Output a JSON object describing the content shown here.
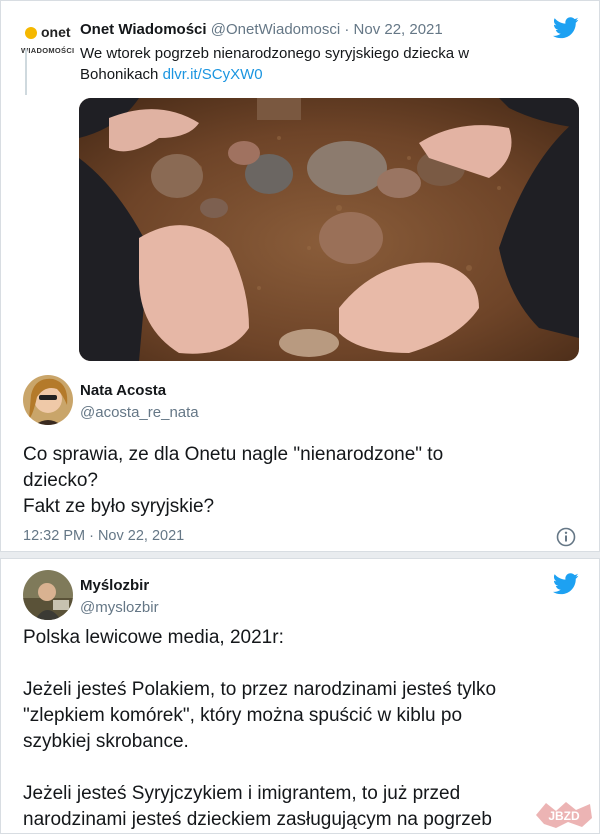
{
  "tweet1": {
    "quoted": {
      "logo_word": "onet",
      "logo_sub": "WIADOMOŚCI",
      "author_name": "Onet Wiadomości",
      "author_handle": "@OnetWiadomosci",
      "date": "Nov 22, 2021",
      "separator": "·",
      "text": "We wtorek pogrzeb nienarodzonego syryjskiego dziecka w Bohonikach",
      "link": "dlvr.it/SCyXW0"
    },
    "author_name": "Nata Acosta",
    "author_handle": "@acosta_re_nata",
    "text_lines": [
      "Co sprawia, ze dla Onetu nagle \"nienarodzone\" to",
      "dziecko?",
      "Fakt ze było syryjskie?"
    ],
    "timestamp": "12:32 PM · Nov 22, 2021"
  },
  "tweet2": {
    "author_name": "Myślozbir",
    "author_handle": "@myslozbir",
    "text_lines": [
      "Polska lewicowe media, 2021r:",
      "",
      "Jeżeli jesteś Polakiem, to przez narodzinami jesteś tylko",
      "\"zlepkiem komórek\", który można spuścić w kiblu po",
      "szybkiej skrobance.",
      "",
      "Jeżeli jesteś Syryjczykiem i imigrantem, to już przed",
      "narodzinami jesteś dzieckiem zasługującym na pogrzeb"
    ]
  },
  "watermark": "JBZD",
  "colors": {
    "twitter_blue": "#1da1f2",
    "link": "#1b95e0",
    "text": "#14171a",
    "secondary": "#657786",
    "onet_yellow": "#f5b800"
  },
  "icons": [
    "twitter-bird-icon",
    "info-icon",
    "onet-logo"
  ]
}
